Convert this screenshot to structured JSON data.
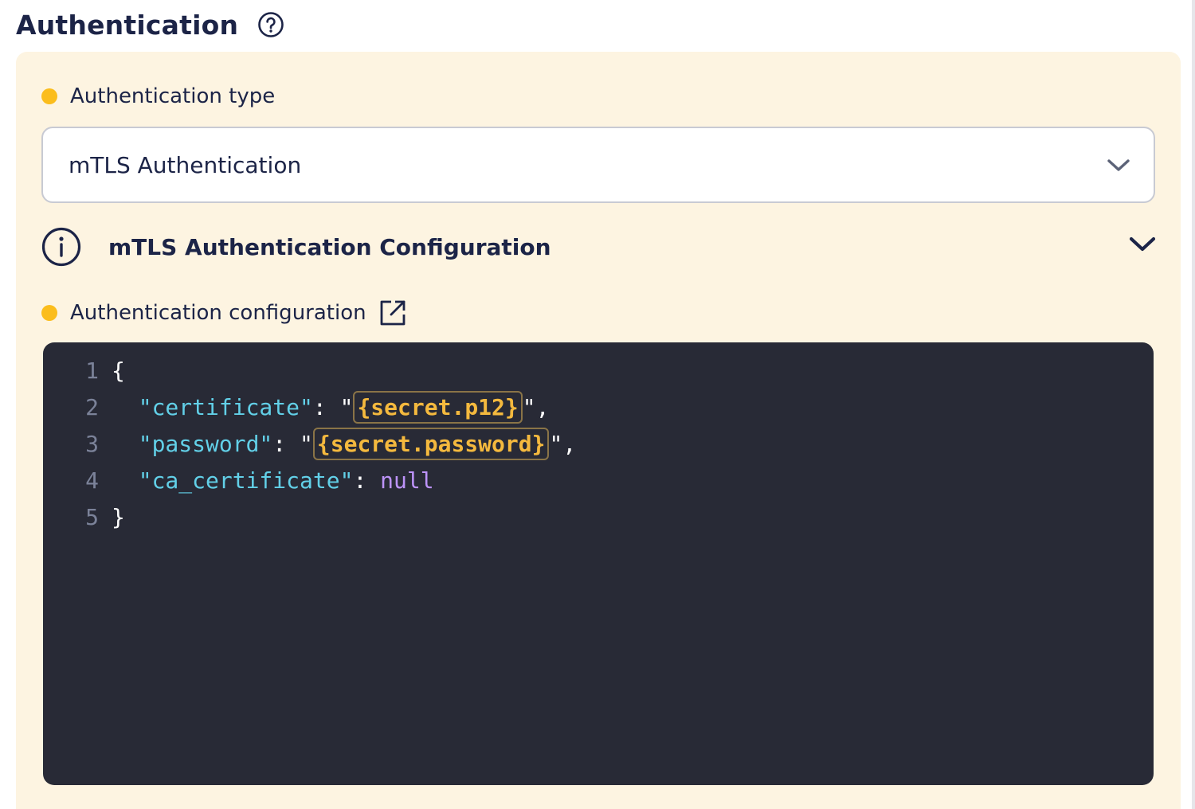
{
  "section": {
    "title": "Authentication",
    "help_icon": "question-circle-icon"
  },
  "auth_type": {
    "label": "Authentication type",
    "selected": "mTLS Authentication",
    "required_indicator_color": "#fbbd1c",
    "chevron_icon": "chevron-down-icon"
  },
  "config_section": {
    "title": "mTLS Authentication Configuration",
    "info_icon": "info-circle-icon",
    "toggle_icon": "chevron-down-icon"
  },
  "auth_config": {
    "label": "Authentication configuration",
    "open_icon": "external-link-icon",
    "editor_background": "#282a36",
    "lines": [
      {
        "n": "1",
        "open_brace": "{"
      },
      {
        "n": "2",
        "key": "\"certificate\"",
        "sep": ": ",
        "q_open": "\"",
        "value": "{secret.p12}",
        "q_close": "\"",
        "tail": ","
      },
      {
        "n": "3",
        "key": "\"password\"",
        "sep": ": ",
        "q_open": "\"",
        "value": "{secret.password}",
        "q_close": "\"",
        "tail": ","
      },
      {
        "n": "4",
        "key": "\"ca_certificate\"",
        "sep": ": ",
        "value": "null"
      },
      {
        "n": "5",
        "close_brace": "}"
      }
    ]
  },
  "colors": {
    "accent_yellow": "#fbbd1c",
    "panel_bg": "#fdf4e1",
    "text_dark": "#1c2447",
    "json_key": "#62d0e8",
    "json_template": "#f4b93e",
    "json_null": "#bd93f9"
  }
}
